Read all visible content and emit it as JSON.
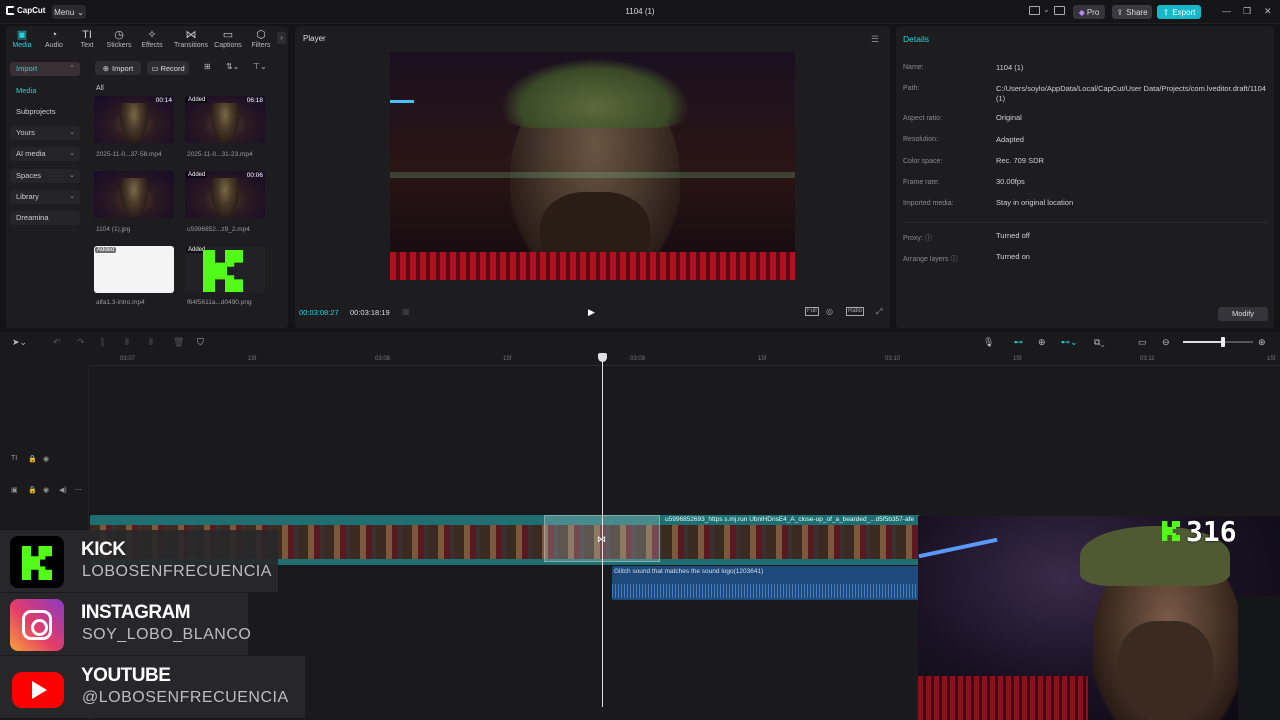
{
  "app": {
    "name": "CapCut",
    "menu_label": "Menu",
    "window_title": "1104 (1)",
    "pro_label": "Pro",
    "share_label": "Share",
    "export_label": "Export"
  },
  "media_tabs": [
    {
      "label": "Media",
      "icon": "media-icon"
    },
    {
      "label": "Audio",
      "icon": "audio-icon"
    },
    {
      "label": "Text",
      "icon": "text-icon"
    },
    {
      "label": "Stickers",
      "icon": "stickers-icon"
    },
    {
      "label": "Effects",
      "icon": "effects-icon"
    },
    {
      "label": "Transitions",
      "icon": "transitions-icon"
    },
    {
      "label": "Captions",
      "icon": "captions-icon"
    },
    {
      "label": "Filters",
      "icon": "filters-icon"
    }
  ],
  "side_nav": {
    "import": "Import",
    "media": "Media",
    "subprojects": "Subprojects",
    "yours": "Yours",
    "ai_media": "AI media",
    "spaces": "Spaces",
    "library": "Library",
    "dreamina": "Dreamina"
  },
  "media_toolbar": {
    "import_label": "Import",
    "record_label": "Record",
    "all_label": "All"
  },
  "media_items": [
    {
      "name": "2025-11-0...37-58.mp4",
      "duration": "00:14",
      "added": false,
      "kind": "video"
    },
    {
      "name": "2025-11-0...31-23.mp4",
      "duration": "06:18",
      "added": true,
      "kind": "video"
    },
    {
      "name": "1104 (1).jpg",
      "duration": "",
      "added": false,
      "kind": "video"
    },
    {
      "name": "u5996852...z9_2.mp4",
      "duration": "00:06",
      "added": true,
      "kind": "video"
    },
    {
      "name": "alfa1.3-intro.mp4",
      "duration": "",
      "added": true,
      "kind": "white"
    },
    {
      "name": "f64f5611a...d0490.png",
      "duration": "",
      "added": true,
      "kind": "kick"
    }
  ],
  "added_label": "Added",
  "player": {
    "title": "Player",
    "current_time": "00:03:08:27",
    "total_time": "00:03:18:19",
    "full_label": "Full",
    "ratio_label": "Ratio"
  },
  "details": {
    "title": "Details",
    "rows": [
      {
        "key": "Name:",
        "value": "1104 (1)"
      },
      {
        "key": "Path:",
        "value": "C:/Users/soylo/AppData/Local/CapCut/User Data/Projects/com.lveditor.draft/1104 (1)"
      },
      {
        "key": "Aspect ratio:",
        "value": "Original"
      },
      {
        "key": "Resolution:",
        "value": "Adapted"
      },
      {
        "key": "Color space:",
        "value": "Rec. 709 SDR"
      },
      {
        "key": "Frame rate:",
        "value": "30.00fps"
      },
      {
        "key": "Imported media:",
        "value": "Stay in original location"
      },
      {
        "key": "Proxy:",
        "value": "Turned off"
      },
      {
        "key": "Arrange layers",
        "value": "Turned on"
      }
    ],
    "modify_label": "Modify"
  },
  "ruler": [
    {
      "label": "03:07"
    },
    {
      "label": "15f"
    },
    {
      "label": "03:08"
    },
    {
      "label": "15f"
    },
    {
      "label": "03:09"
    },
    {
      "label": "15f"
    },
    {
      "label": "03:10"
    },
    {
      "label": "15f"
    },
    {
      "label": "03:11"
    },
    {
      "label": "15f"
    }
  ],
  "timeline": {
    "video_clip_label": "u5996852693_https s.mj.run UbnlHDnsE4_A_close-up_of_a_bearded_...d5f5b357-afe",
    "audio_clip_label": "Glitch sound that matches the sound logo(1203641)",
    "zoom_level": 0.57
  },
  "overlay": {
    "socials": [
      {
        "title": "KICK",
        "handle": "LOBOSENFRECUENCIA"
      },
      {
        "title": "INSTAGRAM",
        "handle": "SOY_LOBO_BLANCO"
      },
      {
        "title": "YOUTUBE",
        "handle": "@LOBOSENFRECUENCIA"
      }
    ],
    "viewer_count": "316"
  },
  "colors": {
    "accent": "#1fd4e0",
    "kick_green": "#53fc18",
    "youtube_red": "#ff0000",
    "video_clip": "#1f6f72",
    "audio_clip": "#1d4a7a"
  }
}
